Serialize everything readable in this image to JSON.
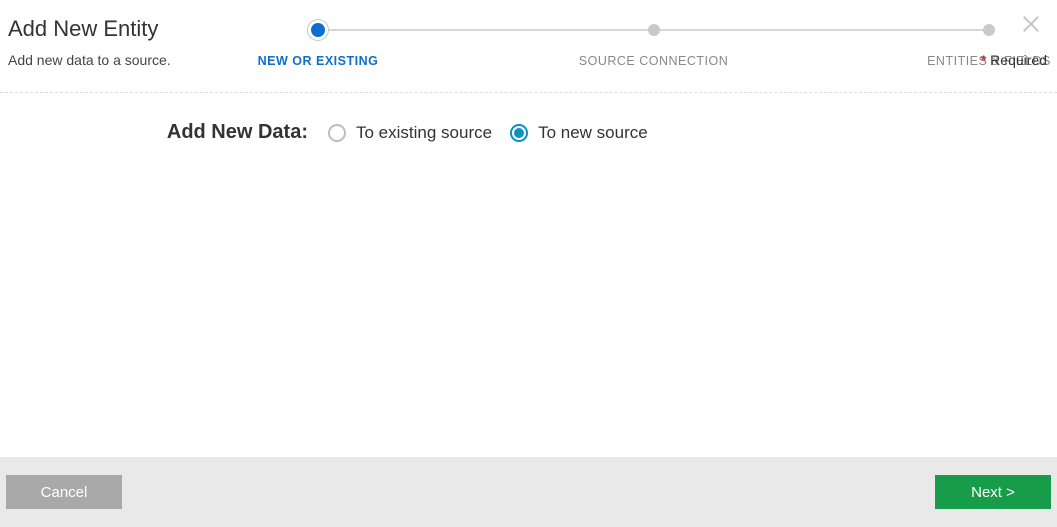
{
  "header": {
    "title": "Add New Entity",
    "subtitle": "Add new data to a source.",
    "required_label": "Required"
  },
  "stepper": {
    "steps": [
      {
        "label": "NEW OR EXISTING",
        "active": true
      },
      {
        "label": "SOURCE CONNECTION",
        "active": false
      },
      {
        "label": "ENTITIES & FIELDS",
        "active": false
      }
    ]
  },
  "form": {
    "prompt": "Add New Data:",
    "options": [
      {
        "label": "To existing source",
        "selected": false
      },
      {
        "label": "To new source",
        "selected": true
      }
    ]
  },
  "footer": {
    "cancel_label": "Cancel",
    "next_label": "Next >"
  }
}
